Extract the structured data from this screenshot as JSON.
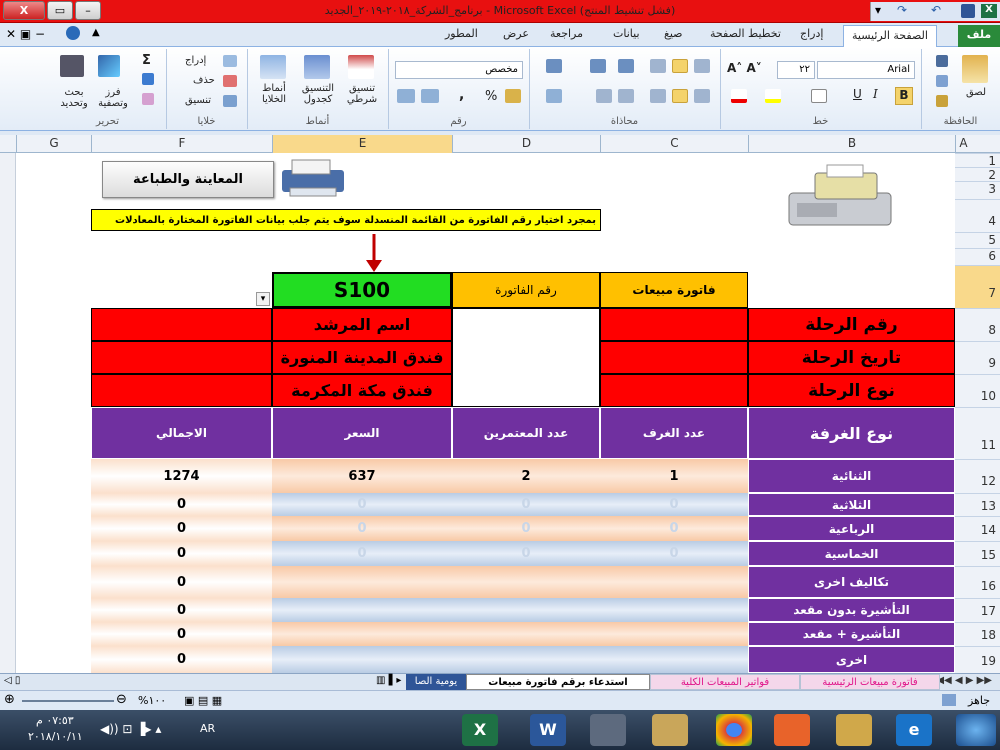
{
  "window": {
    "title": "برنامج_الشركة_٢٠١٨-٢٠١٩_الجديد  -  Microsoft Excel  (فشل تنشيط المنتج)",
    "close_glyph": "X"
  },
  "tabs": {
    "file": "ملف",
    "items": [
      "الصفحة الرئيسية",
      "إدراج",
      "تخطيط الصفحة",
      "صيغ",
      "بيانات",
      "مراجعة",
      "عرض",
      "المطور"
    ]
  },
  "ribbon": {
    "clipboard": {
      "label": "الحافظة",
      "paste": "لصق"
    },
    "font": {
      "label": "خط",
      "name": "Arial",
      "size": "٢٢",
      "bold": "B",
      "italic": "I",
      "underline": "U"
    },
    "alignment": {
      "label": "محاذاة"
    },
    "number": {
      "label": "رقم",
      "format": "مخصص",
      "percent": "%",
      "comma": ","
    },
    "styles": {
      "label": "أنماط",
      "conditional": "تنسيق شرطي",
      "as_table": "التنسيق كجدول",
      "cell_styles": "أنماط الخلايا"
    },
    "cells": {
      "label": "خلايا",
      "insert": "إدراج",
      "delete": "حذف",
      "format": "تنسيق"
    },
    "editing": {
      "label": "تحرير",
      "sigma": "Σ",
      "sort": "فرز وتصفية",
      "find": "بحث وتحديد"
    }
  },
  "columns": [
    "A",
    "B",
    "C",
    "D",
    "E",
    "F",
    "G"
  ],
  "rows": [
    "1",
    "2",
    "3",
    "4",
    "5",
    "6",
    "7",
    "8",
    "9",
    "10",
    "11",
    "12",
    "13",
    "14",
    "15",
    "16",
    "17",
    "18",
    "19"
  ],
  "sheet": {
    "print_button": "المعاينة والطباعة",
    "hint": "بمجرد اختيار رقم الفاتورة من القائمة المنسدلة سوف يتم جلب بيانات الفاتورة المختارة بالمعادلات",
    "header_invoice_type": "فاتورة مبيعات",
    "header_invoice_no": "رقم الفاتورة",
    "invoice_value": "S100",
    "trip_number_label": "رقم الرحلة",
    "trip_date_label": "تاريخ الرحلة",
    "trip_type_label": "نوع الرحلة",
    "guide_label": "اسم المرشد",
    "hotel_medina": "فندق المدينة المنورة",
    "hotel_makkah": "فندق مكة المكرمة",
    "table_headers": {
      "room_type": "نوع الغرفة",
      "rooms": "عدد الغرف",
      "pilgrims": "عدد المعتمرين",
      "price": "السعر",
      "total": "الاجمالي"
    },
    "table_rows": [
      {
        "type": "الثنائية",
        "rooms": "1",
        "pilgrims": "2",
        "price": "637",
        "total": "1274"
      },
      {
        "type": "الثلاثية",
        "rooms": "0",
        "pilgrims": "0",
        "price": "0",
        "total": "0"
      },
      {
        "type": "الرباعية",
        "rooms": "0",
        "pilgrims": "0",
        "price": "0",
        "total": "0"
      },
      {
        "type": "الخماسية",
        "rooms": "0",
        "pilgrims": "0",
        "price": "0",
        "total": "0"
      },
      {
        "type": "تكاليف اخرى",
        "rooms": "",
        "pilgrims": "",
        "price": "",
        "total": "0"
      },
      {
        "type": "التأشيرة بدون مقعد",
        "rooms": "",
        "pilgrims": "",
        "price": "",
        "total": "0"
      },
      {
        "type": "التأشيرة + مقعد",
        "rooms": "",
        "pilgrims": "",
        "price": "",
        "total": "0"
      },
      {
        "type": "اخرى",
        "rooms": "",
        "pilgrims": "",
        "price": "",
        "total": "0"
      }
    ]
  },
  "sheet_tabs": [
    "فاتورة مبيعات الرئيسية",
    "فواتير المبيعات الكلية",
    "استدعاء برقم فاتورة مبيعات",
    "يومية الصا"
  ],
  "status": {
    "ready": "جاهز",
    "zoom": "%١٠٠"
  },
  "taskbar": {
    "lang": "AR",
    "time": "٠٧:٥٣ م",
    "date": "٢٠١٨/١٠/١١"
  }
}
